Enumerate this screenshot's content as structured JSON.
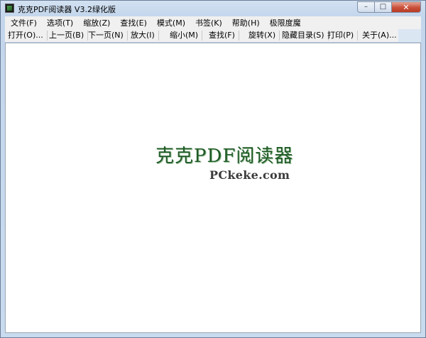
{
  "window": {
    "title": "克克PDF阅读器 V3.2绿化版",
    "caption_buttons": {
      "minimize": "–",
      "maximize": "□",
      "close": "✕"
    }
  },
  "menubar": {
    "items": [
      {
        "label": "文件(F)"
      },
      {
        "label": "选项(T)"
      },
      {
        "label": "缩放(Z)"
      },
      {
        "label": "查找(E)"
      },
      {
        "label": "模式(M)"
      },
      {
        "label": "书签(K)"
      },
      {
        "label": "帮助(H)"
      },
      {
        "label": "极限度魔"
      }
    ]
  },
  "toolbar": {
    "items": [
      {
        "label": "打开(O)..."
      },
      {
        "label": "上一页(B)"
      },
      {
        "label": "下一页(N)"
      },
      {
        "label": "放大(I)"
      },
      {
        "label": "缩小(M)"
      },
      {
        "label": "查找(F)"
      },
      {
        "label": "旋转(X)"
      },
      {
        "label": "隐藏目录(S)"
      },
      {
        "label": "打印(P)"
      },
      {
        "label": "关于(A)..."
      }
    ]
  },
  "content": {
    "logo_title": "克克PDF阅读器",
    "logo_url": "PCkeke.com"
  }
}
